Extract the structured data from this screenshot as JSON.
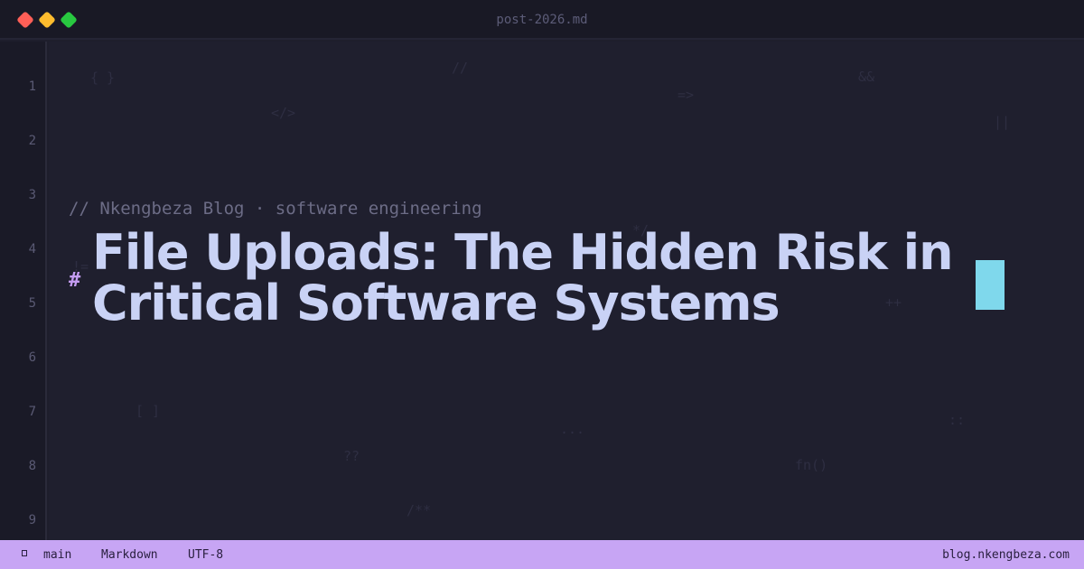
{
  "window": {
    "title": "post-2026.md",
    "controls": [
      "close",
      "minimize",
      "maximize"
    ]
  },
  "gutter": {
    "line_numbers": [
      "1",
      "2",
      "3",
      "4",
      "5",
      "6",
      "7",
      "8",
      "9"
    ]
  },
  "editor": {
    "comment_line": "// Nkengbeza Blog · software engineering",
    "heading_marker": "#",
    "heading": "File Uploads: The Hidden Risk in Critical Software Systems",
    "decorations": [
      "{ }",
      "//",
      "=>",
      "&&",
      "</>",
      "||",
      "*/",
      "!=",
      "++",
      "[ ]",
      "...",
      "::",
      "??",
      "fn()",
      "/**"
    ]
  },
  "statusbar": {
    "branch": "main",
    "language": "Markdown",
    "encoding": "UTF-8",
    "site": "blog.nkengbeza.com"
  },
  "colors": {
    "background": "#1f1f2e",
    "statusbar": "#c7a5f4",
    "heading": "#c9d2f5",
    "cursor": "#7fd8ec",
    "hash": "#c49cf2"
  }
}
